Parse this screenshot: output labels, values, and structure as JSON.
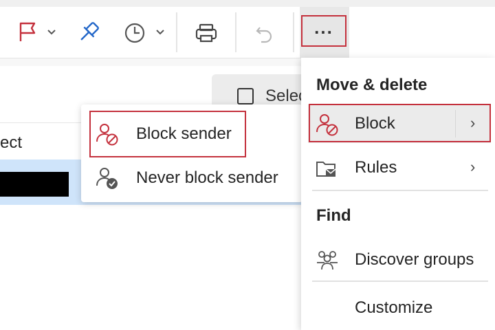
{
  "toolbar": {
    "flag_icon": "flag-icon",
    "pin_icon": "pin-icon",
    "snooze_icon": "clock-icon",
    "print_icon": "printer-icon",
    "undo_icon": "undo-icon",
    "more_label": "...",
    "colors": {
      "flag": "#c4303c",
      "pin": "#2266c8",
      "highlight": "#c4303c"
    }
  },
  "list": {
    "select_label": "Selec",
    "column_header": "ect"
  },
  "block_submenu": {
    "items": [
      {
        "label": "Block sender",
        "icon": "block-person-icon"
      },
      {
        "label": "Never block sender",
        "icon": "person-check-icon"
      }
    ]
  },
  "more_menu": {
    "section_move": "Move & delete",
    "block_label": "Block",
    "rules_label": "Rules",
    "section_find": "Find",
    "discover_label": "Discover groups",
    "customize_label": "Customize"
  }
}
